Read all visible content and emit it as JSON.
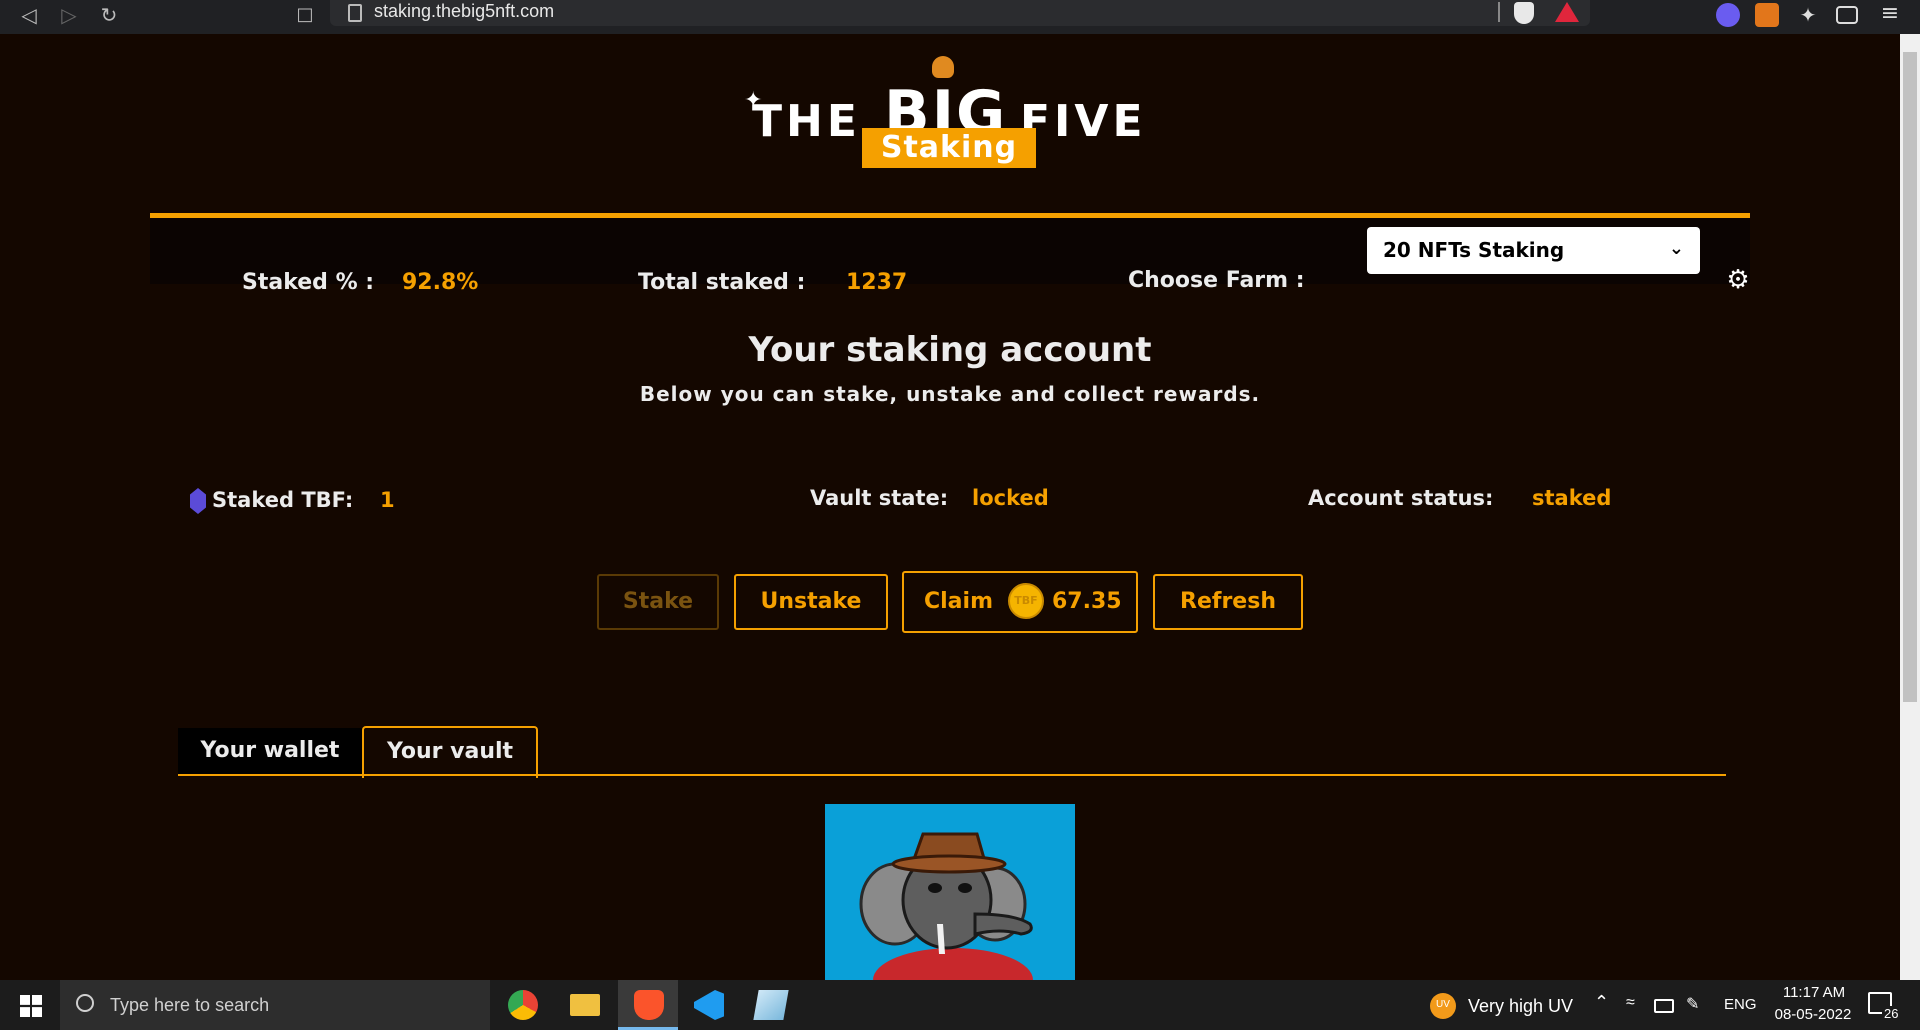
{
  "browser": {
    "url": "staking.thebig5nft.com"
  },
  "header": {
    "logo_word_1": "THE",
    "logo_word_2": "BIG",
    "logo_word_3": "FIVE",
    "banner": "Staking"
  },
  "stats": {
    "staked_pct_label": "Staked % :",
    "staked_pct_value": "92.8%",
    "total_staked_label": "Total staked :",
    "total_staked_value": "1237",
    "choose_farm_label": "Choose Farm :",
    "farm_selected": "20 NFTs Staking"
  },
  "account": {
    "title": "Your staking account",
    "subtitle": "Below you can stake, unstake and collect rewards.",
    "staked_tbf_label": "Staked TBF:",
    "staked_tbf_value": "1",
    "vault_state_label": "Vault state:",
    "vault_state_value": "locked",
    "account_status_label": "Account status:",
    "account_status_value": "staked"
  },
  "actions": {
    "stake": "Stake",
    "unstake": "Unstake",
    "claim": "Claim",
    "claim_amount": "67.35",
    "coin_label": "TBF",
    "refresh": "Refresh"
  },
  "tabs": {
    "wallet": "Your wallet",
    "vault": "Your vault",
    "active": "vault"
  },
  "taskbar": {
    "search_placeholder": "Type here to search",
    "weather": "Very high UV",
    "weather_badge": "UV",
    "language": "ENG",
    "time": "11:17 AM",
    "date": "08-05-2022",
    "notifications": "26"
  },
  "colors": {
    "accent": "#f5a000",
    "background": "#140700",
    "nft_bg": "#0aa0d8"
  }
}
